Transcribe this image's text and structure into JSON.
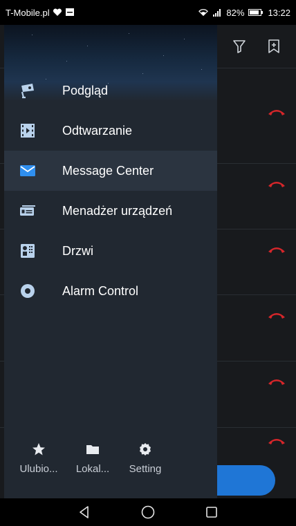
{
  "status_bar": {
    "carrier": "T-Mobile.pl",
    "battery": "82%",
    "time": "13:22"
  },
  "drawer": {
    "menu": [
      {
        "label": "Podgląd",
        "icon": "camera-icon",
        "active": false
      },
      {
        "label": "Odtwarzanie",
        "icon": "film-icon",
        "active": false
      },
      {
        "label": "Message Center",
        "icon": "envelope-icon",
        "active": true
      },
      {
        "label": "Menadżer urządzeń",
        "icon": "device-manager-icon",
        "active": false
      },
      {
        "label": "Drzwi",
        "icon": "door-intercom-icon",
        "active": false
      },
      {
        "label": "Alarm Control",
        "icon": "alarm-icon",
        "active": false
      }
    ],
    "footer": [
      {
        "label": "Ulubio...",
        "icon": "star-icon"
      },
      {
        "label": "Lokal...",
        "icon": "folder-icon"
      },
      {
        "label": "Setting",
        "icon": "gear-icon"
      }
    ]
  },
  "app": {
    "toolbar_icons": [
      "filter-icon",
      "add-bookmark-icon"
    ]
  },
  "colors": {
    "accent": "#1f76d6",
    "hangup": "#d6262a",
    "drawer_bg": "#212831",
    "active_bg": "#2b3440"
  }
}
